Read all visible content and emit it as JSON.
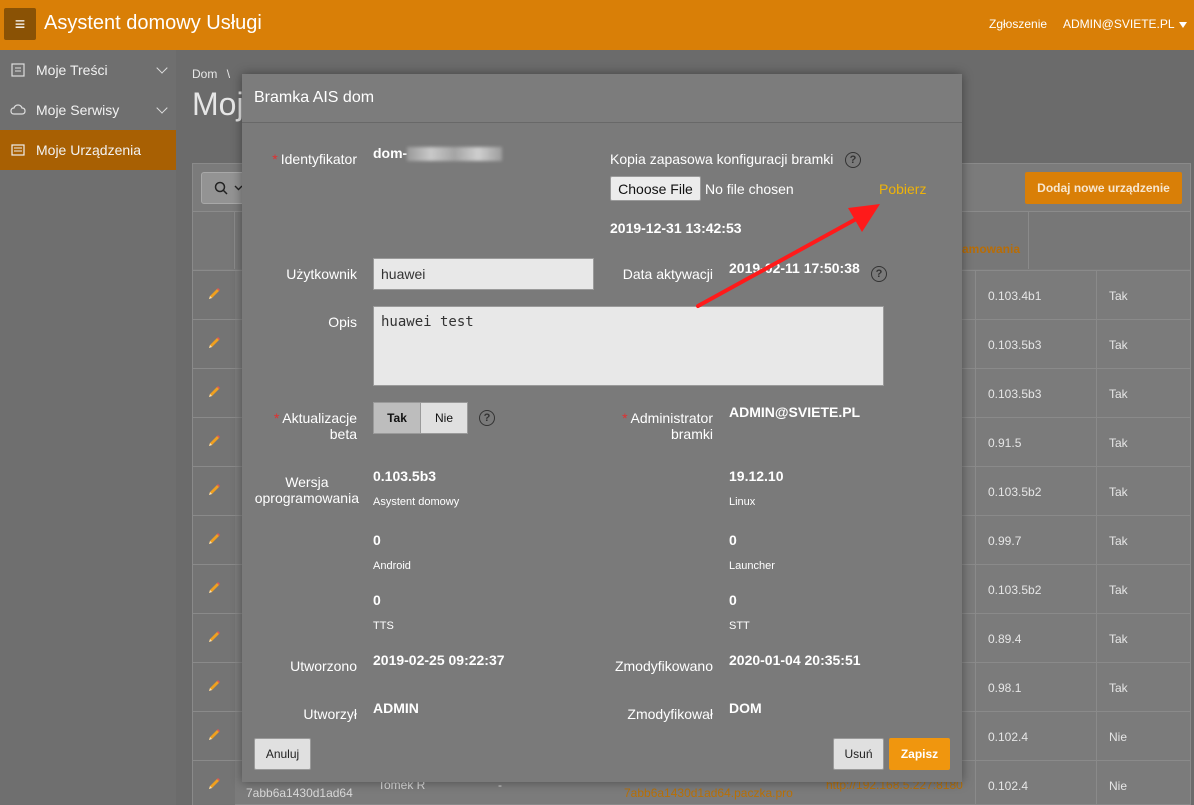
{
  "header": {
    "title": "Asystent domowy Usługi",
    "link_reports": "Zgłoszenie",
    "user": "ADMIN@SVIETE.PL"
  },
  "sidebar": {
    "items": [
      {
        "label": "Moje Treści"
      },
      {
        "label": "Moje Serwisy"
      },
      {
        "label": "Moje Urządzenia"
      }
    ]
  },
  "page": {
    "breadcrumb": "Dom",
    "breadcrumb_sep": "\\",
    "title": "Moj",
    "add_button": "Dodaj nowe urządzenie",
    "col_header_partial": "amowania",
    "rows": [
      {
        "version": "0.103.4b1",
        "active": "Tak"
      },
      {
        "version": "0.103.5b3",
        "active": "Tak"
      },
      {
        "version": "0.103.5b3",
        "active": "Tak"
      },
      {
        "version": "0.91.5",
        "active": "Tak"
      },
      {
        "version": "0.103.5b2",
        "active": "Tak"
      },
      {
        "version": "0.99.7",
        "active": "Tak"
      },
      {
        "version": "0.103.5b2",
        "active": "Tak"
      },
      {
        "version": "0.89.4",
        "active": "Tak"
      },
      {
        "version": "0.98.1",
        "active": "Tak"
      },
      {
        "version": "0.102.4",
        "active": "Nie"
      },
      {
        "version": "0.102.4",
        "active": "Nie"
      }
    ],
    "last_row": {
      "id": "7abb6a1430d1ad64",
      "user": "Tomek R",
      "dash": "-",
      "host": "7abb6a1430d1ad64.paczka.pro",
      "url": "http://192.168.5.227:8180"
    }
  },
  "modal": {
    "title": "Bramka AIS dom",
    "id_label": "Identyfikator",
    "id_value": "dom-",
    "backup_label": "Kopia zapasowa konfiguracji bramki",
    "file_button": "Choose File",
    "file_none": "No file chosen",
    "download_link": "Pobierz",
    "backup_date": "2019-12-31 13:42:53",
    "user_label": "Użytkownik",
    "user_value": "huawei",
    "activation_label": "Data aktywacji",
    "activation_value": "2019-02-11 17:50:38",
    "desc_label": "Opis",
    "desc_value": "huawei test",
    "beta_label_1": "Aktualizacje",
    "beta_label_2": "beta",
    "beta_yes": "Tak",
    "beta_no": "Nie",
    "admin_label_1": "Administrator",
    "admin_label_2": "bramki",
    "admin_value": "ADMIN@SVIETE.PL",
    "version_label_1": "Wersja",
    "version_label_2": "oprogramowania",
    "versions": [
      {
        "value": "0.103.5b3",
        "name": "Asystent domowy"
      },
      {
        "value": "19.12.10",
        "name": "Linux"
      },
      {
        "value": "0",
        "name": "Android"
      },
      {
        "value": "0",
        "name": "Launcher"
      },
      {
        "value": "0",
        "name": "TTS"
      },
      {
        "value": "0",
        "name": "STT"
      }
    ],
    "created_label": "Utworzono",
    "created_value": "2019-02-25 09:22:37",
    "modified_label": "Zmodyfikowano",
    "modified_value": "2020-01-04 20:35:51",
    "created_by_label": "Utworzył",
    "created_by_value": "ADMIN",
    "modified_by_label": "Zmodyfikował",
    "modified_by_value": "DOM",
    "cancel_button": "Anuluj",
    "delete_button": "Usuń",
    "save_button": "Zapisz",
    "help_glyph": "?"
  },
  "colors": {
    "header": "#d97f07",
    "accent": "#f0960e",
    "link": "#eeb30a",
    "arrow": "#ff1a1a",
    "required": "#e23030"
  }
}
